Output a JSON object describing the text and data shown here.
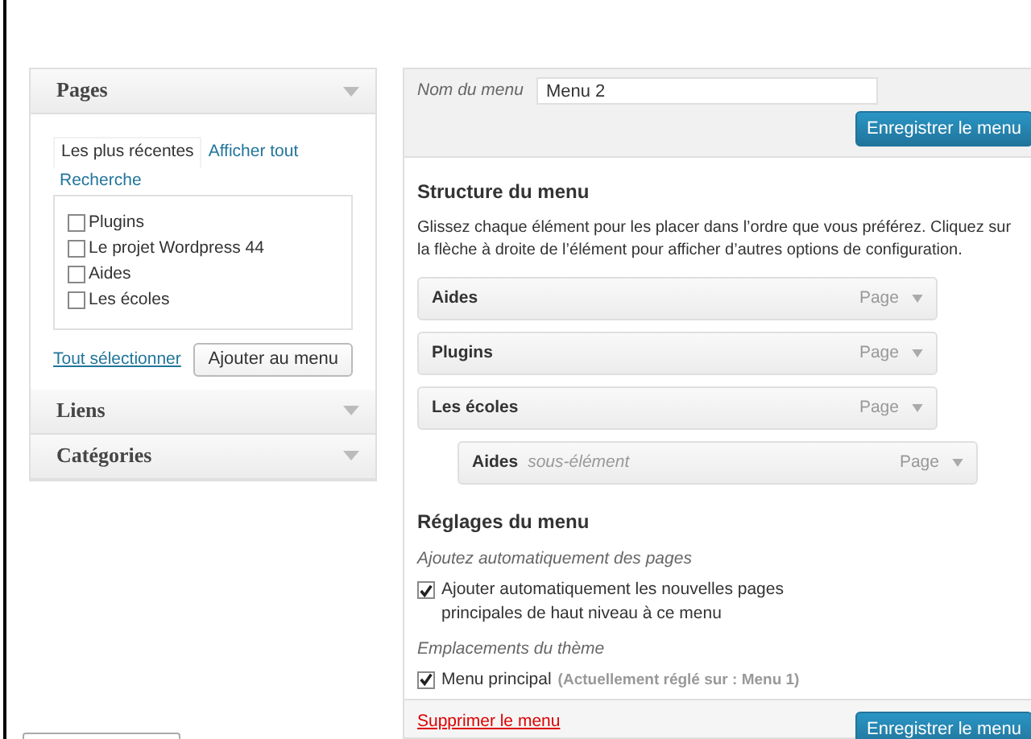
{
  "sidebar": {
    "sections": [
      {
        "title": "Pages",
        "expanded": true,
        "tabs": [
          {
            "label": "Les plus récentes",
            "selected": true
          },
          {
            "label": "Afficher tout",
            "selected": false
          },
          {
            "label": "Recherche",
            "selected": false
          }
        ],
        "items": [
          {
            "label": "Plugins",
            "checked": false
          },
          {
            "label": "Le projet Wordpress 44",
            "checked": false
          },
          {
            "label": "Aides",
            "checked": false
          },
          {
            "label": "Les écoles",
            "checked": false
          }
        ],
        "select_all": "Tout sélectionner",
        "add_button": "Ajouter au menu"
      },
      {
        "title": "Liens",
        "expanded": false
      },
      {
        "title": "Catégories",
        "expanded": false
      }
    ]
  },
  "menu_editor": {
    "name_label": "Nom du menu",
    "name_value": "Menu 2",
    "save_button": "Enregistrer le menu",
    "structure": {
      "title": "Structure du menu",
      "description": "Glissez chaque élément pour les placer dans l’ordre que vous préférez. Cliquez sur la flèche à droite de l’élément pour afficher d’autres options de configuration.",
      "items": [
        {
          "title": "Aides",
          "type": "Page"
        },
        {
          "title": "Plugins",
          "type": "Page"
        },
        {
          "title": "Les écoles",
          "type": "Page",
          "children": [
            {
              "title": "Aides",
              "subtitle": "sous-élément",
              "type": "Page"
            }
          ]
        }
      ]
    },
    "settings": {
      "title": "Réglages du menu",
      "groups": [
        {
          "label": "Ajoutez automatiquement des pages",
          "options": [
            {
              "label": "Ajouter automatiquement les nouvelles pages principales de haut niveau à ce menu",
              "checked": true
            }
          ]
        },
        {
          "label": "Emplacements du thème",
          "options": [
            {
              "label": "Menu principal",
              "note": "(Actuellement réglé sur : Menu 1)",
              "checked": true
            }
          ]
        }
      ]
    },
    "delete_link": "Supprimer le menu",
    "footer_save_button": "Enregistrer le menu"
  }
}
